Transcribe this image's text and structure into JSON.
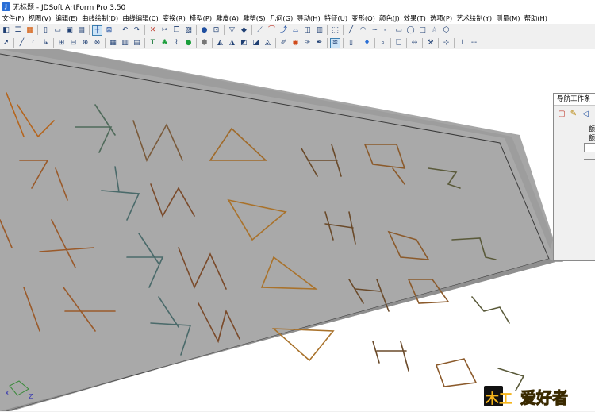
{
  "window": {
    "title": "无标题 - JDSoft ArtForm Pro 3.50"
  },
  "menu": [
    "文件(F)",
    "视图(V)",
    "编辑(E)",
    "曲线绘制(D)",
    "曲线编辑(C)",
    "变换(R)",
    "模型(P)",
    "雕皮(A)",
    "雕塑(S)",
    "几何(G)",
    "导动(H)",
    "特征(U)",
    "变形(Q)",
    "颜色(J)",
    "效果(T)",
    "选项(P)",
    "艺术绘制(Y)",
    "测量(M)",
    "帮助(H)"
  ],
  "toolbar1": [
    "layers-icon",
    "list-icon",
    "color-icon",
    "|",
    "new-icon",
    "open-icon",
    "save-icon",
    "print-icon",
    "|",
    "grid-snap-icon",
    "frame-icon",
    "|",
    "undo-icon",
    "redo-icon",
    "|",
    "delete-icon",
    "cut-icon",
    "copy-icon",
    "paste-icon",
    "|",
    "sphere-icon",
    "box-icon",
    "|",
    "shade-icon",
    "render-icon",
    "|",
    "knife-icon",
    "curve-a-icon",
    "curve-b-icon",
    "curve-c-icon",
    "surface-icon",
    "cube-icon",
    "|",
    "select-icon",
    "|",
    "line-icon",
    "arc-icon",
    "wave-icon",
    "polyline-icon",
    "rect-icon",
    "ellipse-icon",
    "square-icon",
    "star-icon",
    "polygon-icon"
  ],
  "toolbar2": [
    "arrow-icon",
    "|",
    "line2-icon",
    "arc2-icon",
    "curve2-icon",
    "|",
    "node-a-icon",
    "node-b-icon",
    "node-c-icon",
    "node-d-icon",
    "|",
    "grid2-icon",
    "bars-icon",
    "book-icon",
    "|",
    "t-tool-icon",
    "tree-icon",
    "join-icon",
    "dot-icon",
    "|",
    "hex-icon",
    "|",
    "model-a-icon",
    "model-b-icon",
    "model-c-icon",
    "model-d-icon",
    "model-e-icon",
    "|",
    "brush-a-icon",
    "ball-icon",
    "brush-b-icon",
    "brush-c-icon",
    "|",
    "wave2-icon",
    "|",
    "doc-icon",
    "|",
    "drop-icon",
    "|",
    "zoom-icon",
    "|",
    "doc2-icon",
    "|",
    "arrows-icon",
    "|",
    "tools-icon",
    "|",
    "xyz-icon",
    "|",
    "axis-icon",
    "xyz2-icon"
  ],
  "navigator": {
    "title": "导航工作条",
    "rows": [
      "额",
      "额"
    ]
  },
  "watermark": {
    "text": "爱好者",
    "prefix": "木工"
  }
}
